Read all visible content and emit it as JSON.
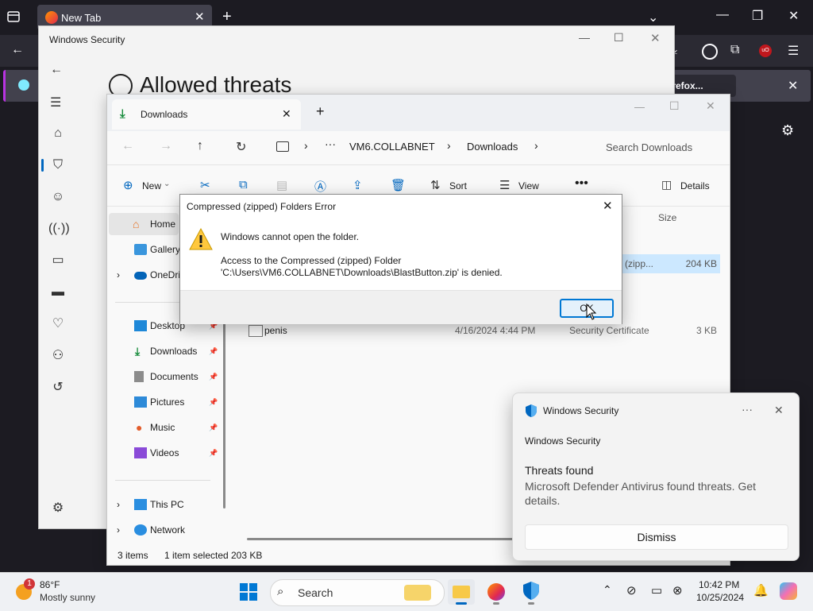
{
  "firefox": {
    "tab_title": "New Tab",
    "notification_text": "h Firefox...",
    "new_tab_icon": "plus-icon",
    "colors": {
      "accent": "#b833e1",
      "dark": "#1c1b22"
    }
  },
  "winsec": {
    "title": "Windows Security",
    "page_title": "Allowed threats",
    "nav_icons": [
      "home-icon",
      "shield-icon",
      "account-icon",
      "firewall-icon",
      "app-browser-icon",
      "device-security-icon",
      "health-icon",
      "family-icon",
      "history-icon",
      "settings-icon"
    ]
  },
  "explorer": {
    "tab_title": "Downloads",
    "breadcrumb": [
      "VM6.COLLABNET",
      "Downloads"
    ],
    "search_placeholder": "Search Downloads",
    "cmd": {
      "new": "New",
      "sort": "Sort",
      "view": "View",
      "details": "Details"
    },
    "column_size": "Size",
    "sidebar": {
      "home": "Home",
      "gallery": "Gallery",
      "onedrive": "OneDri",
      "pinned": [
        "Desktop",
        "Downloads",
        "Documents",
        "Pictures",
        "Music",
        "Videos"
      ],
      "this_pc": "This PC",
      "network": "Network"
    },
    "rows": [
      {
        "name": "",
        "date": "",
        "type": "(zipp...",
        "size": "204 KB"
      },
      {
        "name": "penis",
        "date": "4/16/2024 4:44 PM",
        "type": "Security Certificate",
        "size": "3 KB"
      }
    ],
    "status": {
      "items": "3 items",
      "selected": "1 item selected",
      "selected_size": "203 KB"
    }
  },
  "dialog": {
    "title": "Compressed (zipped) Folders Error",
    "message": "Windows cannot open the folder.",
    "detail_line1": "Access to the Compressed (zipped) Folder",
    "detail_line2": "'C:\\Users\\VM6.COLLABNET\\Downloads\\BlastButton.zip' is denied.",
    "ok": "OK"
  },
  "toast": {
    "app": "Windows Security",
    "source": "Windows Security",
    "heading": "Threats found",
    "body": "Microsoft Defender Antivirus found threats. Get details.",
    "dismiss": "Dismiss"
  },
  "taskbar": {
    "weather_badge": "1",
    "temp": "86°F",
    "condition": "Mostly sunny",
    "search": "Search",
    "time": "10:42 PM",
    "date": "10/25/2024"
  }
}
